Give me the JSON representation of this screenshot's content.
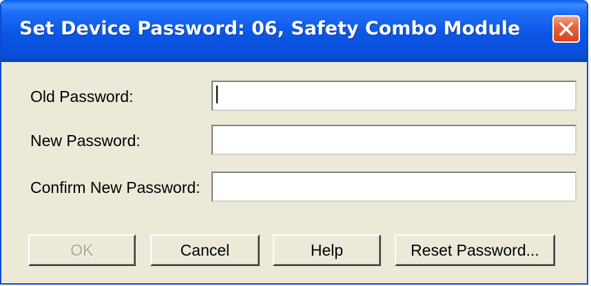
{
  "dialog": {
    "title": "Set Device Password: 06, Safety Combo Module",
    "close_icon": "close-icon"
  },
  "form": {
    "old_password_label": "Old Password:",
    "new_password_label": "New Password:",
    "confirm_password_label": "Confirm New Password:",
    "old_password_value": "",
    "new_password_value": "",
    "confirm_password_value": ""
  },
  "buttons": {
    "ok_label": "OK",
    "cancel_label": "Cancel",
    "help_label": "Help",
    "reset_label": "Reset Password..."
  },
  "colors": {
    "titlebar": "#0a4fd9",
    "dialog_bg": "#ece9d8",
    "close_button": "#d9431b"
  }
}
